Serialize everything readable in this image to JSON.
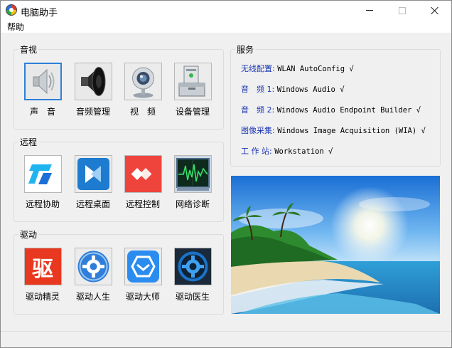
{
  "window": {
    "title": "电脑助手"
  },
  "menu": {
    "items": [
      {
        "label": "帮助"
      }
    ]
  },
  "groups": {
    "media": {
      "title": "音视",
      "items": [
        {
          "label": "声　音",
          "icon": "speaker-icon"
        },
        {
          "label": "音频管理",
          "icon": "audio-speaker-icon"
        },
        {
          "label": "视　频",
          "icon": "webcam-icon"
        },
        {
          "label": "设备管理",
          "icon": "device-manager-icon"
        }
      ]
    },
    "remote": {
      "title": "远程",
      "items": [
        {
          "label": "远程协助",
          "icon": "todesk-icon"
        },
        {
          "label": "远程桌面",
          "icon": "remote-desktop-icon"
        },
        {
          "label": "远程控制",
          "icon": "anydesk-icon"
        },
        {
          "label": "网络诊断",
          "icon": "network-monitor-icon"
        }
      ]
    },
    "drivers": {
      "title": "驱动",
      "items": [
        {
          "label": "驱动精灵",
          "icon": "driver-genius-icon",
          "glyph": "驱"
        },
        {
          "label": "驱动人生",
          "icon": "driver-life-icon"
        },
        {
          "label": "驱动大师",
          "icon": "driver-master-icon"
        },
        {
          "label": "驱动医生",
          "icon": "driver-doctor-icon"
        }
      ]
    }
  },
  "services": {
    "title": "服务",
    "rows": [
      {
        "key": "无线配置:",
        "value": "WLAN AutoConfig √"
      },
      {
        "key": "音　频 1:",
        "value": "Windows Audio √"
      },
      {
        "key": "音　频 2:",
        "value": "Windows Audio Endpoint Builder √"
      },
      {
        "key": "图像采集:",
        "value": "Windows Image Acquisition (WIA) √"
      },
      {
        "key": "工 作 站:",
        "value": "Workstation √"
      }
    ]
  },
  "colors": {
    "service_key": "#1a36b4",
    "selection": "#2f7fd9",
    "window_bg": "#f0f0f0"
  }
}
